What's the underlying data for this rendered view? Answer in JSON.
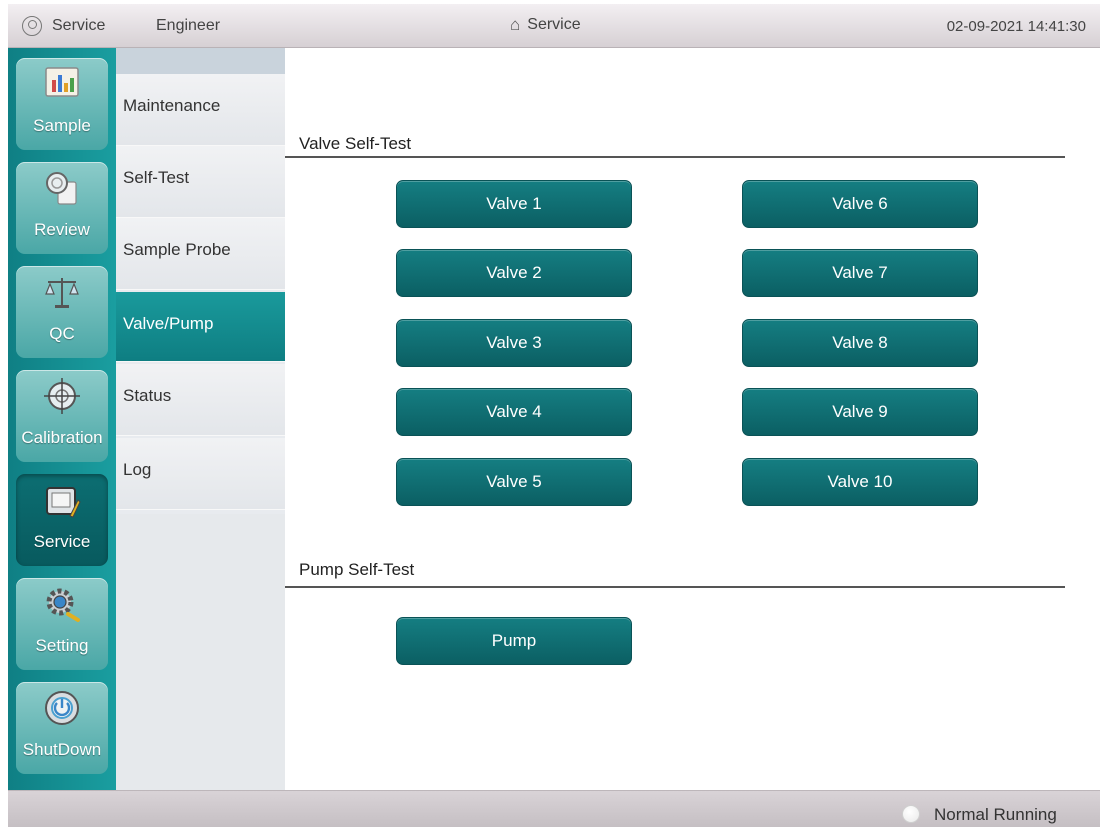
{
  "header": {
    "user_role": "Service",
    "user_level": "Engineer",
    "title": "Service",
    "datetime": "02-09-2021 14:41:30"
  },
  "modules": [
    {
      "label": "Sample",
      "icon": "sample-chart-icon",
      "active": false
    },
    {
      "label": "Review",
      "icon": "review-magnifier-icon",
      "active": false
    },
    {
      "label": "QC",
      "icon": "qc-balance-icon",
      "active": false
    },
    {
      "label": "Calibration",
      "icon": "calibration-crosshair-icon",
      "active": false
    },
    {
      "label": "Service",
      "icon": "service-toolbox-icon",
      "active": true
    },
    {
      "label": "Setting",
      "icon": "setting-gear-icon",
      "active": false
    },
    {
      "label": "ShutDown",
      "icon": "shutdown-power-icon",
      "active": false
    }
  ],
  "submenu": [
    {
      "label": "Maintenance",
      "active": false
    },
    {
      "label": "Self-Test",
      "active": false
    },
    {
      "label": "Sample Probe",
      "active": false
    },
    {
      "label": "Valve/Pump",
      "active": true
    },
    {
      "label": "Status",
      "active": false
    },
    {
      "label": "Log",
      "active": false
    }
  ],
  "valve_section": {
    "title": "Valve Self-Test",
    "buttons": [
      "Valve 1",
      "Valve 2",
      "Valve 3",
      "Valve 4",
      "Valve 5",
      "Valve 6",
      "Valve 7",
      "Valve 8",
      "Valve 9",
      "Valve 10"
    ]
  },
  "pump_section": {
    "title": "Pump Self-Test",
    "buttons": [
      "Pump"
    ]
  },
  "status": {
    "text": "Normal Running"
  },
  "colors": {
    "accent": "#127a7e",
    "button": "#0e6a6e",
    "module_bar": "#1a9ea0"
  }
}
